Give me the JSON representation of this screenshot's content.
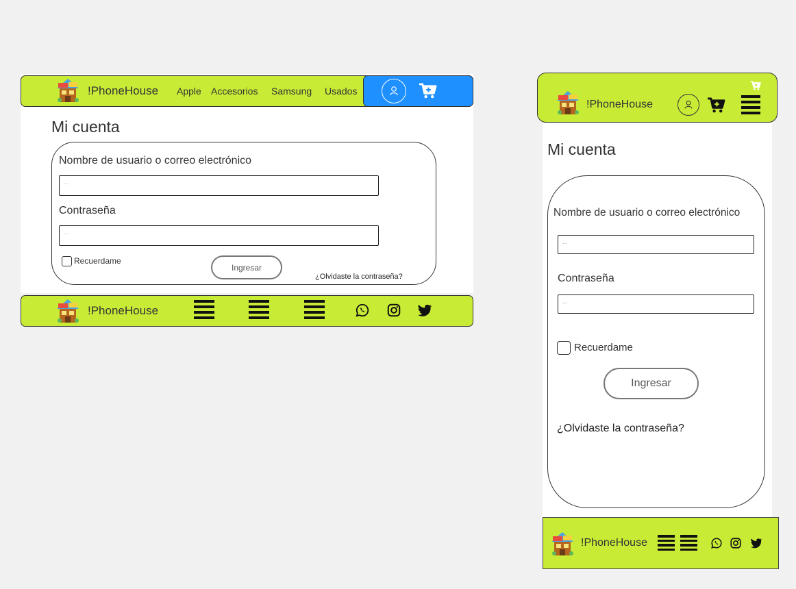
{
  "brand": {
    "name": "!PhoneHouse"
  },
  "desktop": {
    "nav": [
      "Apple",
      "Accesorios",
      "Samsung",
      "Usados"
    ],
    "title": "Mi cuenta",
    "form": {
      "username_label": "Nombre de usuario o correo electrónico",
      "username_value": "...",
      "password_label": "Contraseña",
      "password_value": "...",
      "remember_label": "Recuerdame",
      "submit_label": "Ingresar",
      "forgot_label": "¿Olvidaste la contraseña?"
    }
  },
  "mobile": {
    "title": "Mi cuenta",
    "form": {
      "username_label": "Nombre de usuario o correo electrónico",
      "username_value": "...",
      "password_label": "Contraseña",
      "password_value": "...",
      "remember_label": "Recuerdame",
      "submit_label": "Ingresar",
      "forgot_label": "¿Olvidaste la contraseña?"
    }
  },
  "icons": {
    "user": "user-circle-icon",
    "cart": "cart-plus-icon",
    "menu": "hamburger-icon",
    "whatsapp": "whatsapp-icon",
    "instagram": "instagram-icon",
    "twitter": "twitter-icon"
  },
  "colors": {
    "lime": "#c8eb36",
    "accent_blue": "#1e90ff",
    "background": "#f1f1f1"
  }
}
